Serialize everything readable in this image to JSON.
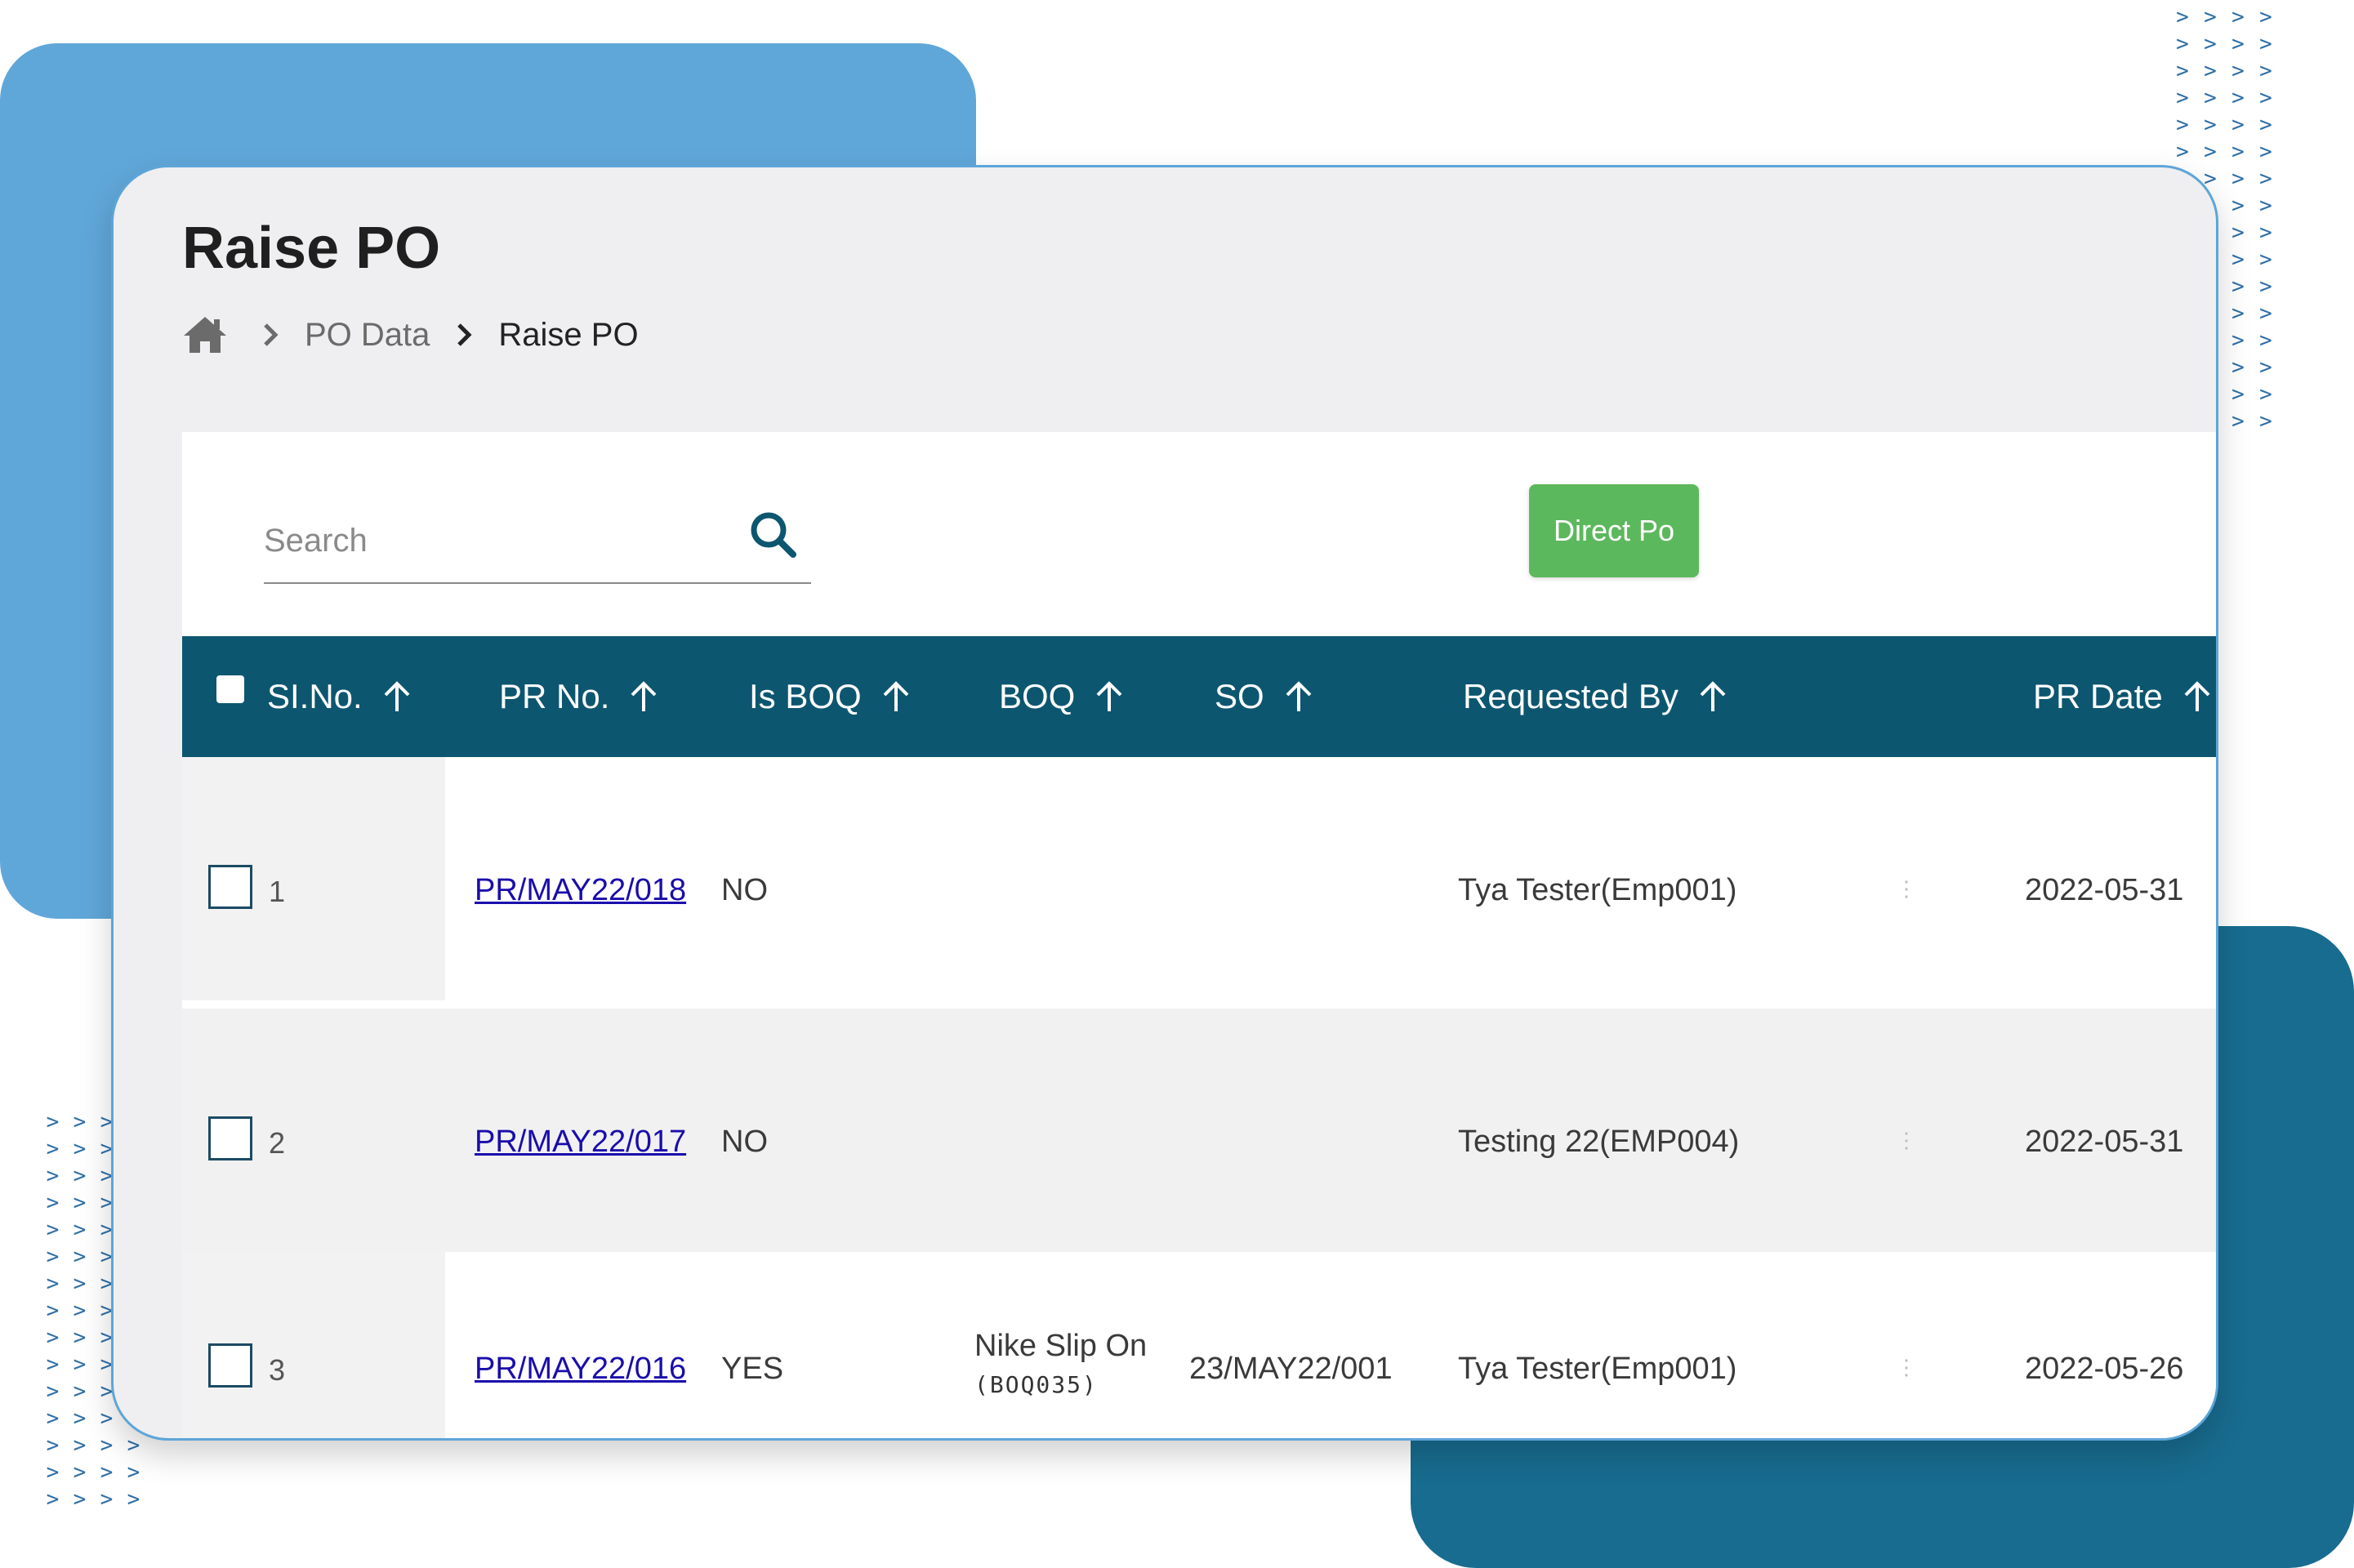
{
  "page": {
    "title": "Raise PO"
  },
  "breadcrumb": {
    "home_icon": "home-icon",
    "items": [
      "PO Data",
      "Raise PO"
    ]
  },
  "search": {
    "placeholder": "Search",
    "icon": "search-icon"
  },
  "toolbar": {
    "direct_po_label": "Direct Po"
  },
  "table": {
    "columns": [
      "SI.No.",
      "PR No.",
      "Is BOQ",
      "BOQ",
      "SO",
      "Requested By",
      "PR Date"
    ],
    "rows": [
      {
        "sl": "1",
        "pr_no": "PR/MAY22/018",
        "is_boq": "NO",
        "boq_name": "",
        "boq_code": "",
        "so": "",
        "requested_by": "Tya Tester(Emp001)",
        "pr_date": "2022-05-31"
      },
      {
        "sl": "2",
        "pr_no": "PR/MAY22/017",
        "is_boq": "NO",
        "boq_name": "",
        "boq_code": "",
        "so": "",
        "requested_by": "Testing 22(EMP004)",
        "pr_date": "2022-05-31"
      },
      {
        "sl": "3",
        "pr_no": "PR/MAY22/016",
        "is_boq": "YES",
        "boq_name": "Nike Slip On",
        "boq_code": "(BOQ035)",
        "so": "23/MAY22/001",
        "requested_by": "Tya Tester(Emp001)",
        "pr_date": "2022-05-26"
      }
    ]
  },
  "colors": {
    "header_bg": "#0d5670",
    "button_green": "#5cb85c",
    "link": "#1a0dab",
    "accent_blue": "#60a7d9",
    "accent_teal": "#186c8f"
  }
}
